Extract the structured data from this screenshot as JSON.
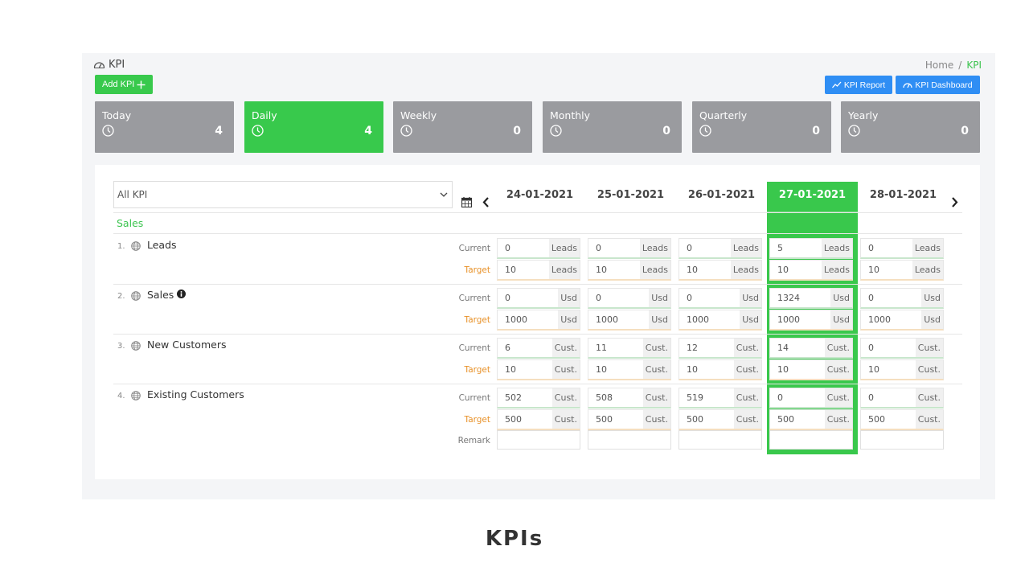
{
  "header": {
    "title": "KPI",
    "breadcrumb": [
      "Home",
      "/",
      "KPI"
    ],
    "add_button": "Add KPI",
    "report_button": "KPI Report",
    "dashboard_button": "KPI Dashboard"
  },
  "periods": [
    {
      "label": "Today",
      "count": "4",
      "active": false
    },
    {
      "label": "Daily",
      "count": "4",
      "active": true
    },
    {
      "label": "Weekly",
      "count": "0",
      "active": false
    },
    {
      "label": "Monthly",
      "count": "0",
      "active": false
    },
    {
      "label": "Quarterly",
      "count": "0",
      "active": false
    },
    {
      "label": "Yearly",
      "count": "0",
      "active": false
    }
  ],
  "filter": {
    "selected": "All KPI"
  },
  "dates": [
    "24-01-2021",
    "25-01-2021",
    "26-01-2021",
    "27-01-2021",
    "28-01-2021"
  ],
  "active_date_index": 3,
  "section": "Sales",
  "row_labels": {
    "current": "Current",
    "target": "Target",
    "remark": "Remark"
  },
  "kpis": [
    {
      "num": "1.",
      "name": "Leads",
      "info": false,
      "unit": "Leads",
      "current": [
        "0",
        "0",
        "0",
        "5",
        "0"
      ],
      "target": [
        "10",
        "10",
        "10",
        "10",
        "10"
      ],
      "remark": false
    },
    {
      "num": "2.",
      "name": "Sales",
      "info": true,
      "unit": "Usd",
      "current": [
        "0",
        "0",
        "0",
        "1324",
        "0"
      ],
      "target": [
        "1000",
        "1000",
        "1000",
        "1000",
        "1000"
      ],
      "remark": false
    },
    {
      "num": "3.",
      "name": "New Customers",
      "info": false,
      "unit": "Cust.",
      "current": [
        "6",
        "11",
        "12",
        "14",
        "0"
      ],
      "target": [
        "10",
        "10",
        "10",
        "10",
        "10"
      ],
      "remark": false
    },
    {
      "num": "4.",
      "name": "Existing Customers",
      "info": false,
      "unit": "Cust.",
      "current": [
        "502",
        "508",
        "519",
        "0",
        "0"
      ],
      "target": [
        "500",
        "500",
        "500",
        "500",
        "500"
      ],
      "remark": true
    }
  ],
  "footer": "KPIs",
  "colors": {
    "accent": "#38c94c",
    "primary": "#2f8ef4",
    "muted": "#9a9b9f",
    "target": "#e8922a"
  }
}
